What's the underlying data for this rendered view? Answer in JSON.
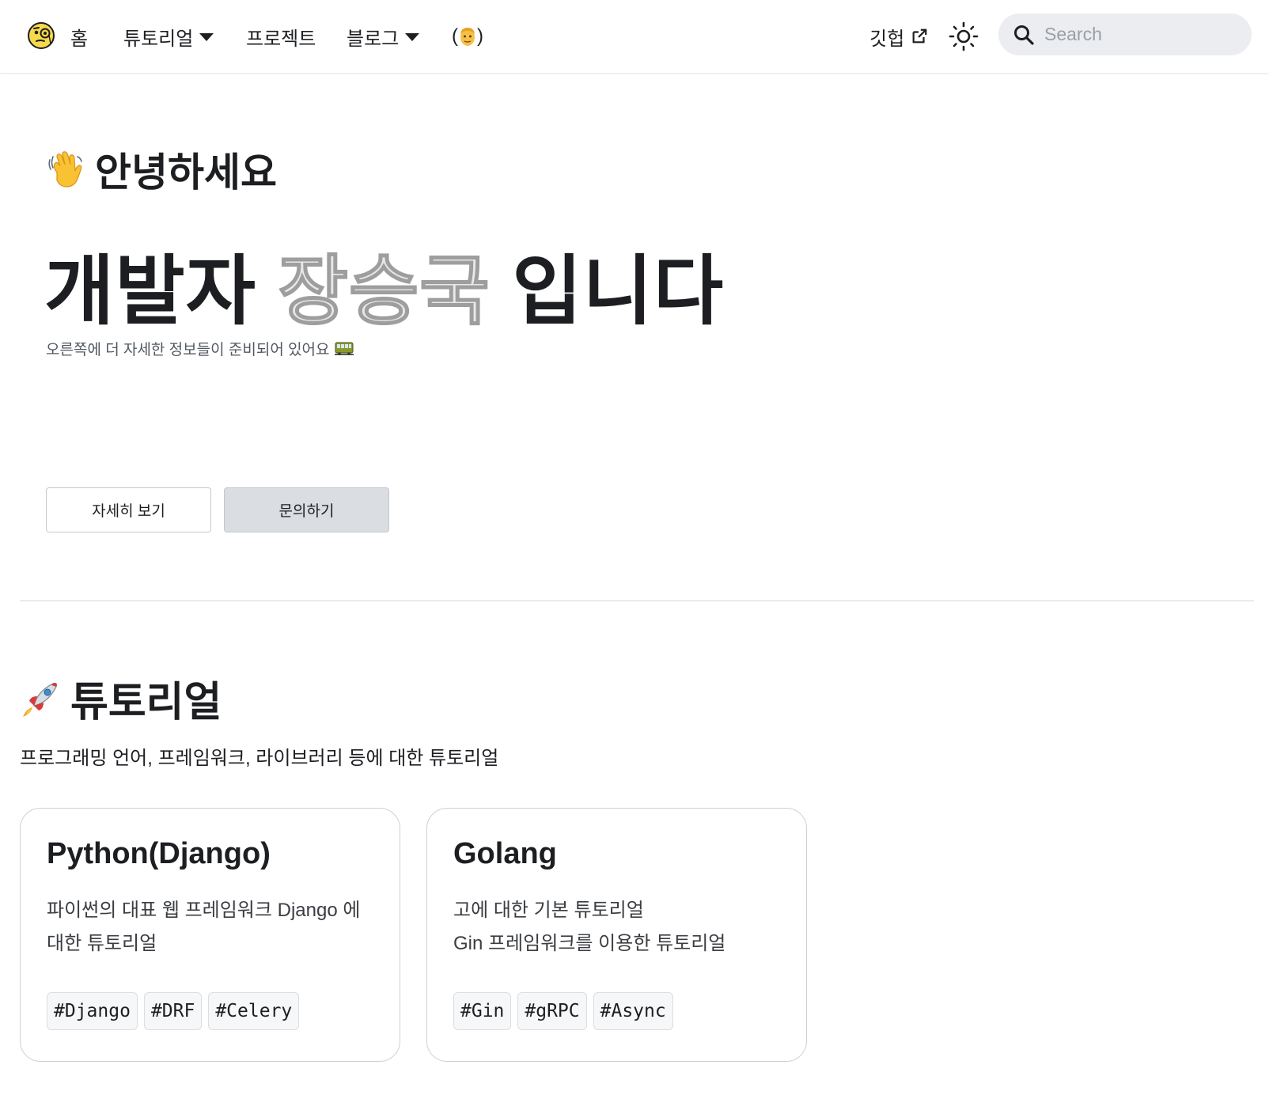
{
  "navbar": {
    "logo_icon": "emoji-monocle-face-icon",
    "home_label": "홈",
    "tutorial_label": "튜토리얼",
    "project_label": "프로젝트",
    "blog_label": "블로그",
    "profile_label_open": "(",
    "profile_icon": "person-emoji-icon",
    "profile_label_close": ")",
    "github_label": "깃헙",
    "search": {
      "placeholder": "Search",
      "value": ""
    }
  },
  "hero": {
    "greeting_icon": "waving-hand-icon",
    "greeting": "안녕하세요",
    "title_prefix": "개발자 ",
    "title_name": "장승국",
    "title_suffix": " 입니다",
    "subtitle": "오른쪽에 더 자세한 정보들이 준비되어 있어요",
    "subtitle_icon": "train-icon",
    "button_detail": "자세히 보기",
    "button_contact": "문의하기"
  },
  "tutorial": {
    "icon": "rocket-icon",
    "title": "튜토리얼",
    "description": "프로그래밍 언어, 프레임워크, 라이브러리 등에 대한 튜토리얼",
    "cards": [
      {
        "title": "Python(Django)",
        "description": "파이썬의 대표 웹 프레임워크 Django 에 대한 튜토리얼",
        "tags": [
          "#Django",
          "#DRF",
          "#Celery"
        ]
      },
      {
        "title": "Golang",
        "description_line1": "고에 대한 기본 튜토리얼",
        "description_line2": "Gin 프레임워크를 이용한 튜토리얼",
        "tags": [
          "#Gin",
          "#gRPC",
          "#Async"
        ]
      }
    ]
  },
  "colors": {
    "text": "#1c1e21",
    "name_fill": "#e8e8e8",
    "name_stroke": "#9e9e9e",
    "search_bg": "#ebedf0",
    "secondary_button": "#dadde1"
  }
}
